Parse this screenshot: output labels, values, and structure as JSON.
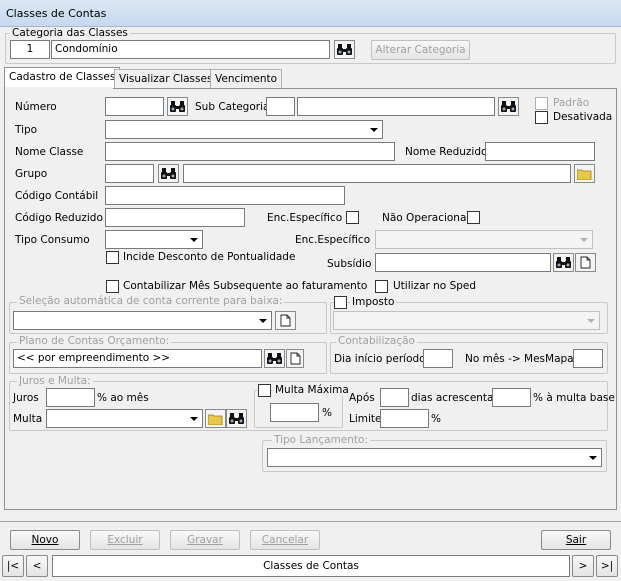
{
  "window": {
    "title": "Classes de Contas"
  },
  "categoria": {
    "legend": "Categoria das Classes",
    "code": "1",
    "name": "Condomínio",
    "alterar_label": "Alterar Categoria"
  },
  "tabs": [
    "Cadastro de Classes",
    "Visualizar Classes",
    "Vencimento"
  ],
  "form": {
    "numero_label": "Número",
    "subcategoria_label": "Sub Categoria",
    "padrao_label": "Padrão",
    "desativada_label": "Desativada",
    "tipo_label": "Tipo",
    "nome_classe_label": "Nome Classe",
    "nome_reduzido_label": "Nome Reduzido",
    "grupo_label": "Grupo",
    "codigo_contabil_label": "Código Contábil",
    "codigo_reduzido_label": "Código Reduzido",
    "enc_especifico_label": "Enc.Específico",
    "nao_operacional_label": "Não Operacional",
    "tipo_consumo_label": "Tipo Consumo",
    "enc_especifico2_label": "Enc.Específico",
    "incide_label": "Incide Desconto de Pontualidade",
    "subsidio_label": "Subsídio",
    "contabilizar_label": "Contabilizar Mês Subsequente ao faturamento",
    "utilizar_sped_label": "Utilizar no Sped"
  },
  "selecao": {
    "legend": "Seleção automática de conta corrente para baixa:"
  },
  "imposto": {
    "label": "Imposto"
  },
  "plano": {
    "legend": "Plano de Contas Orçamento:",
    "value": "<< por empreendimento >>"
  },
  "contabilizacao": {
    "legend": "Contabilização",
    "dia_label": "Dia início período",
    "mes_label": "No mês -> MesMapa+"
  },
  "juros": {
    "legend": "Juros e Multa:",
    "juros_label": "Juros",
    "ao_mes": "% ao mês",
    "multa_label": "Multa",
    "multa_maxima": "Multa Máxima",
    "pct": "%",
    "apos": "Após",
    "dias_acrescentar": "dias acrescentar",
    "multa_base": "% à multa base",
    "limite": "Limite",
    "pct2": "%"
  },
  "tipo_lancamento": {
    "legend": "Tipo Lançamento:"
  },
  "buttons": {
    "novo": "Novo",
    "excluir": "Excluir",
    "gravar": "Gravar",
    "cancelar": "Cancelar",
    "sair": "Sair"
  },
  "nav": {
    "first": "|<",
    "prev": "<",
    "caption": "Classes de Contas",
    "next": ">",
    "last": ">|"
  }
}
